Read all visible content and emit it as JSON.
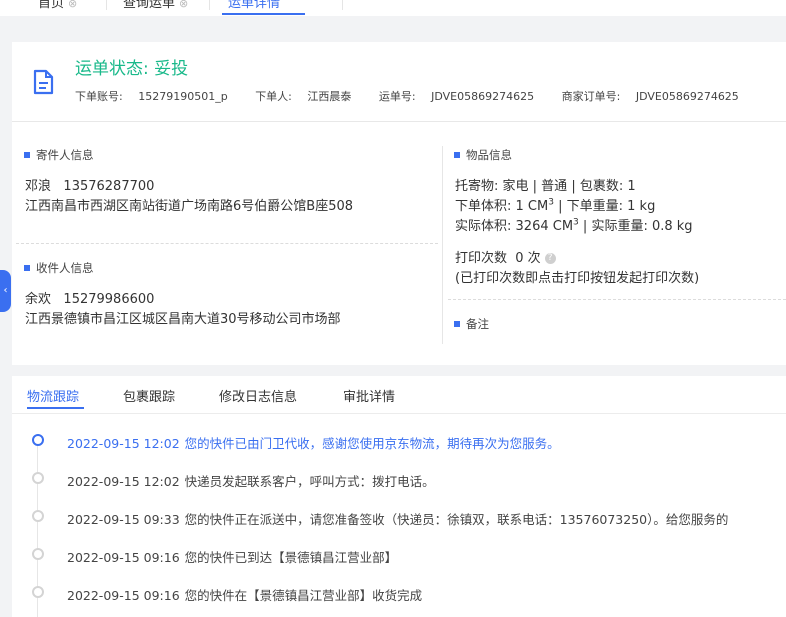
{
  "top_tabs": [
    {
      "label": "首页",
      "close": "⊗"
    },
    {
      "label": "查询运单",
      "close": "⊗"
    },
    {
      "label": "运单详情",
      "close": ""
    }
  ],
  "header": {
    "status_label": "运单状态: 妥投",
    "account_label": "下单账号:",
    "account_value": "15279190501_p",
    "orderer_label": "下单人:",
    "orderer_value": "江西晨泰",
    "waybill_label": "运单号:",
    "waybill_value": "JDVE05869274625",
    "merchant_order_label": "商家订单号:",
    "merchant_order_value": "JDVE05869274625"
  },
  "sender": {
    "title": "寄件人信息",
    "name": "邓浪",
    "phone": "13576287700",
    "address": "江西南昌市西湖区南站街道广场南路6号伯爵公馆B座508"
  },
  "receiver": {
    "title": "收件人信息",
    "name": "余欢",
    "phone": "15279986600",
    "address": "江西景德镇市昌江区城区昌南大道30号移动公司市场部"
  },
  "goods": {
    "title": "物品信息",
    "consignment_label": "托寄物:",
    "consignment_value": "家电 | 普通",
    "package_count_label": "包裹数:",
    "package_count_value": "1",
    "order_volume_label": "下单体积:",
    "order_volume_value": "1 CM",
    "order_weight_label": "下单重量:",
    "order_weight_value": "1 kg",
    "actual_volume_label": "实际体积:",
    "actual_volume_value": "3264 CM",
    "actual_weight_label": "实际重量:",
    "actual_weight_value": "0.8 kg",
    "superscript": "3",
    "print_count_label": "打印次数",
    "print_count_value": "0 次",
    "print_hint": "(已打印次数即点击打印按钮发起打印次数)"
  },
  "remark": {
    "title": "备注"
  },
  "tracking_tabs": [
    "物流跟踪",
    "包裹跟踪",
    "修改日志信息",
    "审批详情"
  ],
  "events": [
    {
      "time": "2022-09-15 12:02",
      "text": "您的快件已由门卫代收，感谢您使用京东物流，期待再次为您服务。",
      "active": true
    },
    {
      "time": "2022-09-15 12:02",
      "text": "快递员发起联系客户，呼叫方式：拨打电话。",
      "active": false
    },
    {
      "time": "2022-09-15 09:33",
      "text": "您的快件正在派送中，请您准备签收（快递员：徐镇双，联系电话：13576073250）。给您服务的",
      "active": false
    },
    {
      "time": "2022-09-15 09:16",
      "text": "您的快件已到达【景德镇昌江营业部】",
      "active": false
    },
    {
      "time": "2022-09-15 09:16",
      "text": "您的快件在【景德镇昌江营业部】收货完成",
      "active": false
    }
  ],
  "colors": {
    "accent": "#3a6ff0",
    "status": "#19b98a"
  }
}
